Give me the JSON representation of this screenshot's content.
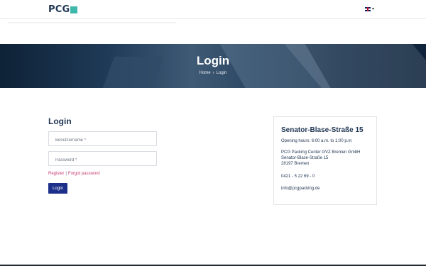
{
  "header": {
    "logo_text": "PCG",
    "logo_square_color": "#3fb8ac",
    "language": {
      "flag": "uk-flag-icon",
      "caret": "▾"
    }
  },
  "hero": {
    "title": "Login",
    "breadcrumbs": [
      "Home",
      "Login"
    ],
    "separator": "›"
  },
  "login": {
    "heading": "Login",
    "username_placeholder": "Benutzername *",
    "password_placeholder": "Password *",
    "register_label": "Register",
    "link_separator": "|",
    "forgot_label": "Forgot password",
    "submit_label": "Login"
  },
  "contact": {
    "title": "Senator-Blase-Straße 15",
    "hours": "Opening hours: 6:00 a.m. to 1:00 p.m",
    "address_lines": [
      "PCG Packing Center GVZ Bremen GmbH",
      "Senator-Blase-Straße 15",
      "28197 Bremen"
    ],
    "phone": "0421 - 5 22 69 - 0",
    "email": "info@pcgpacking.de"
  },
  "colors": {
    "brand_navy": "#1f3552",
    "accent_teal": "#3fb8ac",
    "link_pink": "#c43b70",
    "button_blue": "#1c2f8a"
  }
}
